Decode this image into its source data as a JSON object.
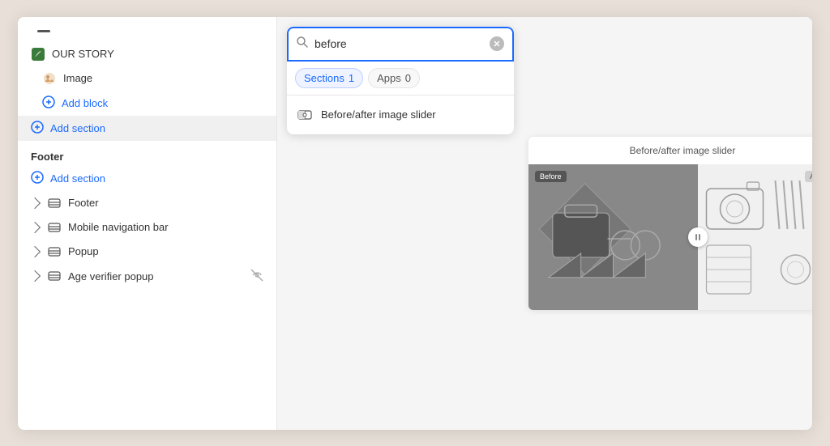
{
  "sidebar": {
    "items": [
      {
        "id": "our-story",
        "label": "OUR STORY",
        "icon": "leaf-icon",
        "type": "section"
      },
      {
        "id": "image",
        "label": "Image",
        "icon": "image-icon",
        "type": "block"
      },
      {
        "id": "add-block",
        "label": "Add block",
        "type": "add-block"
      }
    ],
    "add_section_1": "Add section",
    "footer_label": "Footer",
    "add_section_2": "Add section",
    "footer_items": [
      {
        "id": "footer",
        "label": "Footer",
        "icon": "layout-icon"
      },
      {
        "id": "mobile-nav",
        "label": "Mobile navigation bar",
        "icon": "layout-icon"
      },
      {
        "id": "popup",
        "label": "Popup",
        "icon": "layout-icon"
      },
      {
        "id": "age-verifier",
        "label": "Age verifier popup",
        "icon": "layout-icon",
        "has_eye_slash": true
      }
    ]
  },
  "search_panel": {
    "placeholder": "before",
    "current_value": "before",
    "tabs": [
      {
        "id": "sections",
        "label": "Sections",
        "count": "1",
        "active": true
      },
      {
        "id": "apps",
        "label": "Apps",
        "count": "0",
        "active": false
      }
    ],
    "results": [
      {
        "id": "before-after-slider",
        "label": "Before/after image slider",
        "icon": "before-after-icon"
      }
    ]
  },
  "preview": {
    "title": "Before/after image slider",
    "before_label": "Before",
    "after_label": "After"
  }
}
